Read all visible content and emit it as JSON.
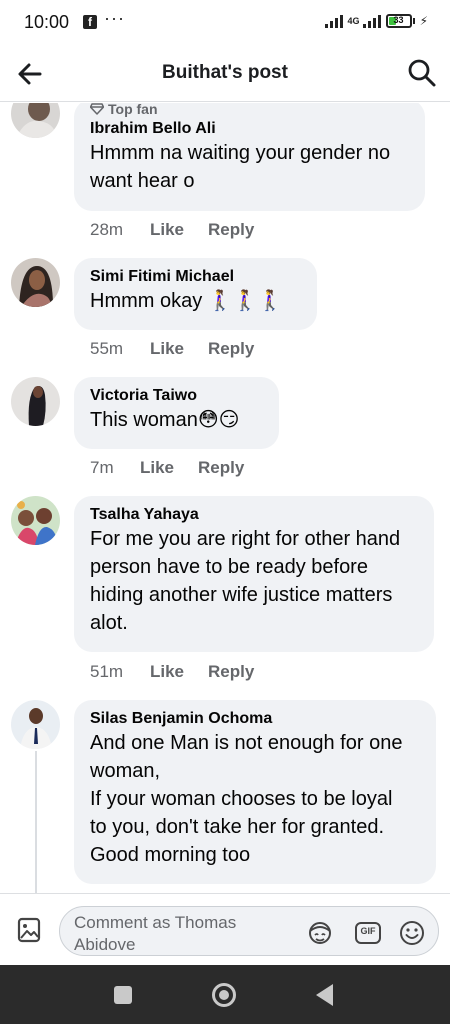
{
  "status_bar": {
    "time": "10:00",
    "app_icon": "facebook-icon",
    "more": "···",
    "network": "4G",
    "battery": "33",
    "battery_level": 0.33
  },
  "header": {
    "title": "Buithat's post",
    "back_icon": "arrow-left-icon",
    "search_icon": "search-icon"
  },
  "comments": [
    {
      "badge": "Top fan",
      "name": "Ibrahim Bello Ali",
      "lines": [
        "Hmmm na waiting your gender no",
        "want hear o"
      ],
      "time": "28m",
      "like": "Like",
      "reply": "Reply"
    },
    {
      "name": "Simi Fitimi Michael",
      "lines": [
        "Hmmm okay 🚶‍♀️🚶‍♀️🚶‍♀️"
      ],
      "time": "55m",
      "like": "Like",
      "reply": "Reply"
    },
    {
      "name": "Victoria Taiwo",
      "lines": [
        "This woman😳😏"
      ],
      "time": "7m",
      "like": "Like",
      "reply": "Reply"
    },
    {
      "name": "Tsalha Yahaya",
      "lines": [
        "For me you are right for other hand",
        "person have to be ready before",
        "hiding another wife justice matters",
        "alot."
      ],
      "time": "51m",
      "like": "Like",
      "reply": "Reply"
    },
    {
      "name": "Silas Benjamin Ochoma",
      "lines": [
        "And one Man is not enough for one",
        "woman,",
        "If your woman chooses to be loyal",
        "to you, don't take her for granted.",
        "Good morning too"
      ]
    }
  ],
  "composer": {
    "placeholder": "Comment as Thomas Abidove",
    "gif": "GIF"
  },
  "colors": {
    "bubble": "#f0f2f5",
    "meta_text": "#65676b",
    "nav_bar": "#2b2b2b"
  }
}
